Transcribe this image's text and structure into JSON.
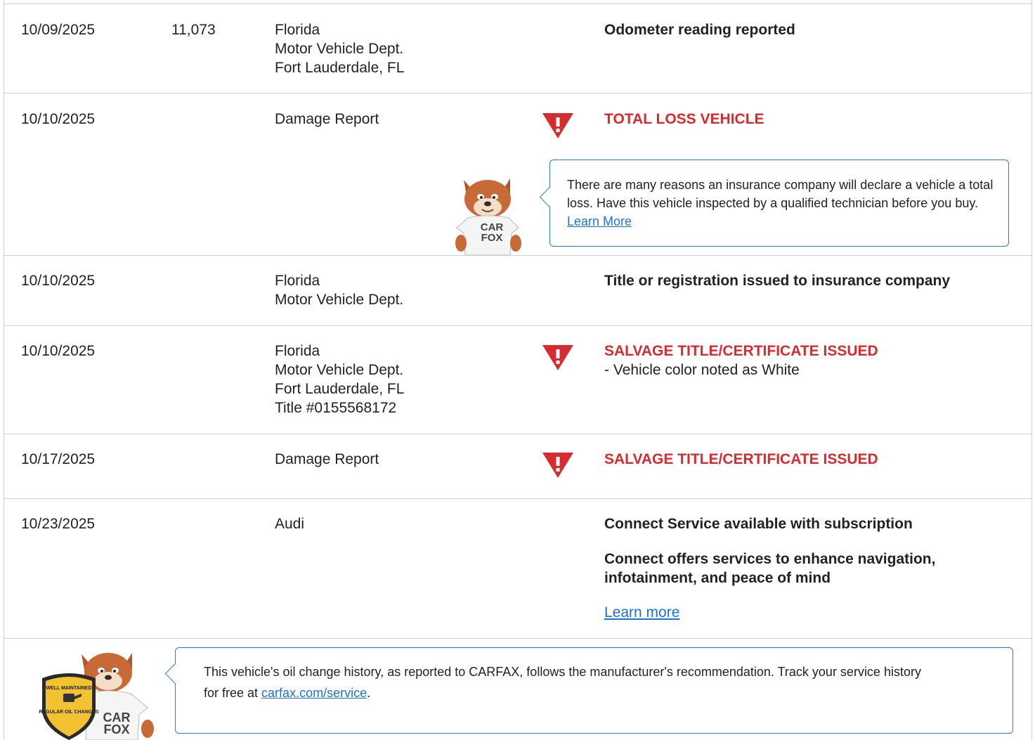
{
  "rows": [
    {
      "date": "10/09/2025",
      "mileage": "11,073",
      "source": [
        "Florida",
        "Motor Vehicle Dept.",
        "Fort Lauderdale, FL"
      ],
      "comment": "Odometer reading reported"
    },
    {
      "date": "10/10/2025",
      "source": [
        "Damage Report"
      ],
      "comment": "TOTAL LOSS VEHICLE",
      "callout": {
        "text": "There are many reasons an insurance company will declare a vehicle a total loss. Have this vehicle inspected by a qualified technician before you buy.",
        "link": "Learn More"
      }
    },
    {
      "date": "10/10/2025",
      "source": [
        "Florida",
        "Motor Vehicle Dept."
      ],
      "comment": "Title or registration issued to insurance company"
    },
    {
      "date": "10/10/2025",
      "source": [
        "Florida",
        "Motor Vehicle Dept.",
        "Fort Lauderdale, FL",
        "Title #0155568172"
      ],
      "comment": "SALVAGE TITLE/CERTIFICATE ISSUED",
      "detail": "- Vehicle color noted as White"
    },
    {
      "date": "10/17/2025",
      "source": [
        "Damage Report"
      ],
      "comment": "SALVAGE TITLE/CERTIFICATE ISSUED"
    },
    {
      "date": "10/23/2025",
      "source": [
        "Audi"
      ],
      "comment": "Connect Service available with subscription",
      "comment2_line1": "Connect offers services to enhance navigation,",
      "comment2_line2": "infotainment, and peace of mind",
      "link": "Learn more"
    }
  ],
  "footer": {
    "text_line1": "This vehicle's oil change history, as reported to CARFAX, follows the manufacturer's recommendation. Track your service history",
    "text_line2_prefix": "for free at ",
    "link": "carfax.com/service",
    "text_line2_suffix": ".",
    "badge_top": "WELL MAINTAINED",
    "badge_bottom": "REGULAR OIL CHANGES"
  },
  "mascot_shirt": [
    "CAR",
    "FOX"
  ],
  "colors": {
    "alert_red": "#d62b2f",
    "link_blue": "#1a73d9",
    "callout_border": "#2f7ad1",
    "divider": "#cfcfcf",
    "badge_gold": "#f2c230"
  },
  "icons": [
    "alert-triangle-icon",
    "carfox-mascot",
    "well-maintained-badge"
  ]
}
